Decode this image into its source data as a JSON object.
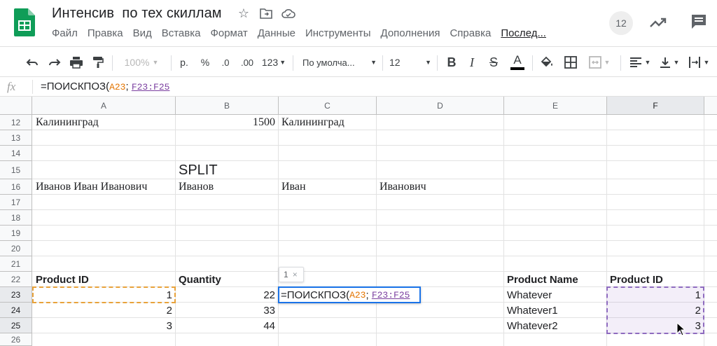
{
  "doc": {
    "title": "Интенсив  по тех скиллам",
    "menu": [
      "Файл",
      "Правка",
      "Вид",
      "Вставка",
      "Формат",
      "Данные",
      "Инструменты",
      "Дополнения",
      "Справка",
      "Послед..."
    ],
    "collaborators_count": "12",
    "icons": [
      "star-icon",
      "move-to-folder-icon",
      "cloud-saved-icon",
      "trending-icon",
      "comment-icon"
    ]
  },
  "toolbar": {
    "zoom": "100%",
    "currency": "р.",
    "percent": "%",
    "decimal_decrease": ".0",
    "decimal_increase": ".00",
    "format_more": "123",
    "font": "По умолча...",
    "font_size": "12",
    "bold": "B",
    "italic": "I",
    "strike": "S",
    "text_color": "A"
  },
  "formula_bar": {
    "fx": "fx",
    "prefix": "=ПОИСКПОЗ(",
    "ref1": "A23",
    "sep": "; ",
    "ref2": "F23:F25"
  },
  "columns": [
    "A",
    "B",
    "C",
    "D",
    "E",
    "F"
  ],
  "rows": [
    "12",
    "13",
    "14",
    "15",
    "16",
    "17",
    "18",
    "19",
    "20",
    "21",
    "22",
    "23",
    "24",
    "25",
    "26"
  ],
  "cells": {
    "a12": "Калининград",
    "b12": "1500",
    "c12": "Калининград",
    "b15": "SPLIT",
    "a16": "Иванов Иван Иванович",
    "b16": "Иванов",
    "c16": "Иван",
    "d16": "Иванович",
    "a22": "Product ID",
    "b22": "Quantity",
    "e22": "Product Name",
    "f22": "Product ID",
    "a23": "1",
    "b23": "22",
    "e23": "Whatever",
    "f23": "1",
    "a24": "2",
    "b24": "33",
    "e24": "Whatever1",
    "f24": "2",
    "a25": "3",
    "b25": "44",
    "e25": "Whatever2",
    "f25": "3"
  },
  "editor": {
    "prefix": "=ПОИСКПОЗ(",
    "ref1": "A23",
    "sep": "; ",
    "ref2": "F23:F25",
    "hint": "1"
  },
  "colors": {
    "ref_orange": "#e37400",
    "ref_purple": "#7b3fa0",
    "editor_border": "#1a73e8",
    "sheets_green": "#0f9d58"
  }
}
